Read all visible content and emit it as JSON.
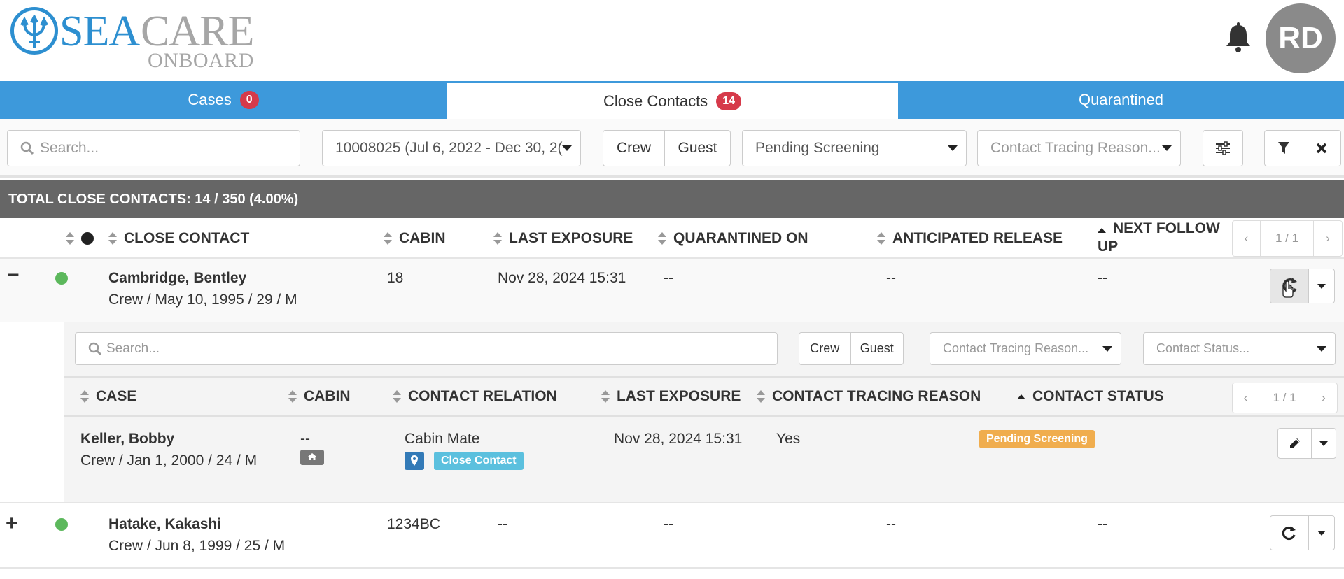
{
  "brand": {
    "sea": "SEA",
    "care": "CARE",
    "onboard": "ONBOARD"
  },
  "user": {
    "initials": "RD"
  },
  "tabs": [
    {
      "label": "Cases",
      "count": "0"
    },
    {
      "label": "Close Contacts",
      "count": "14"
    },
    {
      "label": "Quarantined",
      "count": ""
    }
  ],
  "filters": {
    "search_placeholder": "Search...",
    "voyage": "10008025 (Jul 6, 2022 - Dec 30, 2(",
    "crew_label": "Crew",
    "guest_label": "Guest",
    "status": "Pending Screening",
    "reason_placeholder": "Contact Tracing Reason..."
  },
  "totals": "TOTAL CLOSE CONTACTS: 14 / 350 (4.00%)",
  "columns": {
    "close_contact": "CLOSE CONTACT",
    "cabin": "CABIN",
    "last_exposure": "LAST EXPOSURE",
    "quarantined_on": "QUARANTINED ON",
    "anticipated_release": "ANTICIPATED RELEASE",
    "next_follow_up_1": "NEXT FOLLOW",
    "next_follow_up_2": "UP"
  },
  "pager": {
    "prev": "‹",
    "page": "1 / 1",
    "next": "›"
  },
  "rows": [
    {
      "toggle": "−",
      "name": "Cambridge, Bentley",
      "details": "Crew / May 10, 1995 / 29 / M",
      "cabin": "18",
      "last_exposure": "Nov 28, 2024 15:31",
      "quarantined_on": "--",
      "anticipated_release": "--",
      "next_follow_up": "--"
    },
    {
      "toggle": "+",
      "name": "Hatake, Kakashi",
      "details": "Crew / Jun 8, 1999 / 25 / M",
      "cabin": "1234BC",
      "last_exposure": "--",
      "quarantined_on": "--",
      "anticipated_release": "--",
      "next_follow_up": "--"
    }
  ],
  "sub": {
    "search_placeholder": "Search...",
    "crew_label": "Crew",
    "guest_label": "Guest",
    "reason_placeholder": "Contact Tracing Reason...",
    "status_placeholder": "Contact Status...",
    "columns": {
      "case": "CASE",
      "cabin": "CABIN",
      "contact_relation": "CONTACT RELATION",
      "last_exposure": "LAST EXPOSURE",
      "contact_tracing_reason": "CONTACT TRACING REASON",
      "contact_status": "CONTACT STATUS"
    },
    "pager": {
      "prev": "‹",
      "page": "1 / 1",
      "next": "›"
    },
    "row": {
      "name": "Keller, Bobby",
      "details": "Crew / Jan 1, 2000 / 24 / M",
      "cabin": "--",
      "relation": "Cabin Mate",
      "relation_badge": "Close Contact",
      "last_exposure": "Nov 28, 2024 15:31",
      "reason": "Yes",
      "status": "Pending Screening"
    }
  },
  "colors": {
    "brand_blue": "#2d8fd0",
    "tab_blue": "#3d99db",
    "status_green": "#5cb85c",
    "badge_red": "#d63a4a",
    "pending_orange": "#f0ad4e",
    "contact_cyan": "#5bc0de"
  },
  "icons": [
    "trident-logo-icon",
    "bell-icon",
    "search-icon",
    "sliders-icon",
    "filter-icon",
    "close-icon",
    "refresh-icon",
    "pencil-icon",
    "map-marker-icon",
    "home-icon",
    "pointer-cursor-icon"
  ]
}
